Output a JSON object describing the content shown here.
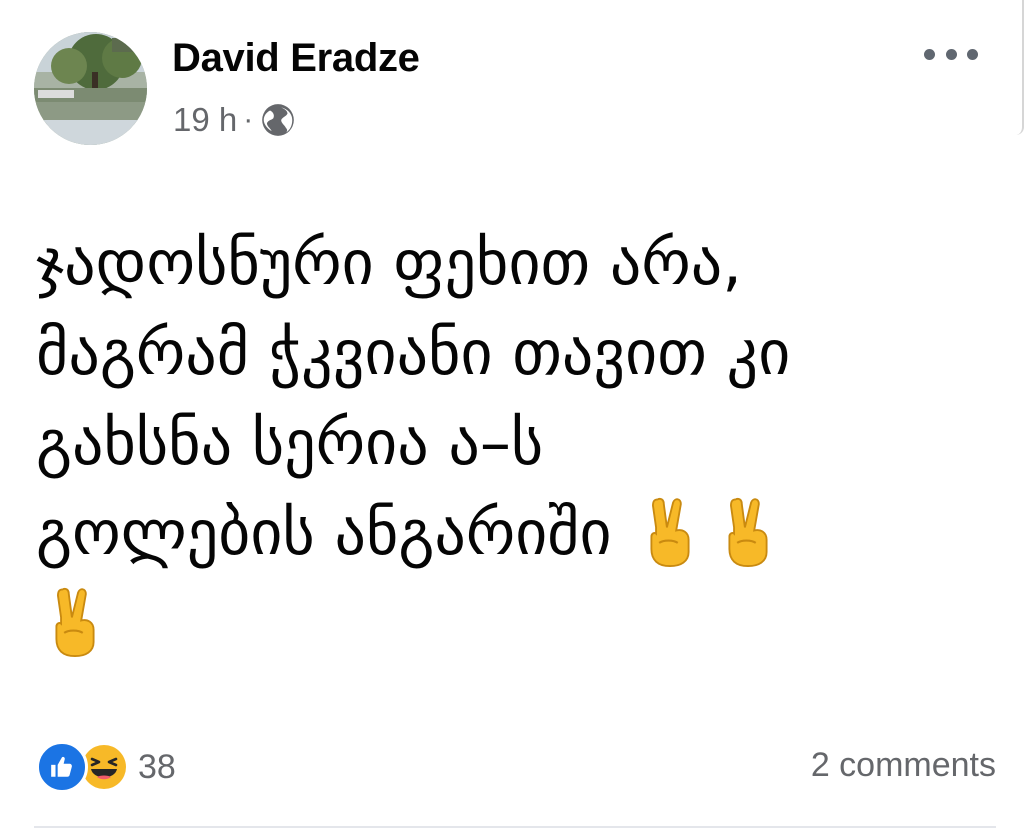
{
  "post": {
    "author": "David Eradze",
    "time": "19 h",
    "meta_separator": "·",
    "privacy_icon": "globe-icon",
    "more_icon": "more-options-icon",
    "text_lines": [
      "ჯადოსნური ფეხით არა,",
      "მაგრამ ჭკვიანი თავით კი",
      "გახსნა სერია ა–ს",
      "გოლების ანგარიში"
    ],
    "emoji": "victory-hand-emoji",
    "emoji_count": 3
  },
  "reactions": {
    "icons": [
      "like-icon",
      "haha-icon"
    ],
    "count": "38"
  },
  "comments": {
    "label": "2 comments"
  },
  "colors": {
    "text": "#050505",
    "secondary": "#65676b",
    "like_blue": "#1b74e4",
    "emoji_yellow": "#f7b928"
  }
}
